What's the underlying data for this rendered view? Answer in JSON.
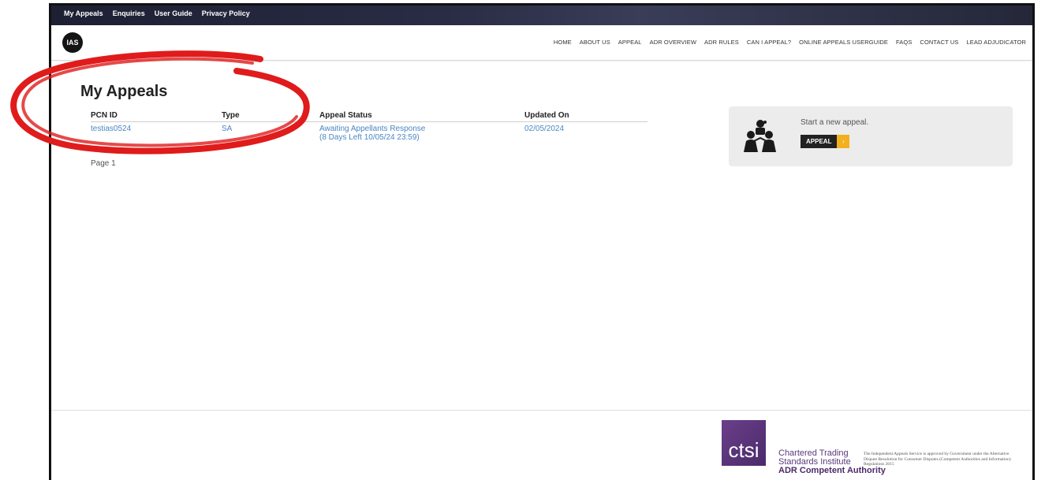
{
  "topbar": {
    "links": [
      "My Appeals",
      "Enquiries",
      "User Guide",
      "Privacy Policy"
    ]
  },
  "header": {
    "logo_text": "IAS",
    "nav": [
      "HOME",
      "ABOUT US",
      "APPEAL",
      "ADR OVERVIEW",
      "ADR RULES",
      "CAN I APPEAL?",
      "ONLINE APPEALS USERGUIDE",
      "FAQS",
      "CONTACT US",
      "LEAD ADJUDICATOR"
    ]
  },
  "main": {
    "title": "My Appeals",
    "table": {
      "headers": [
        "PCN ID",
        "Type",
        "Appeal Status",
        "Updated On"
      ],
      "rows": [
        {
          "pcn_id": "testias0524",
          "type": "SA",
          "status_line1": "Awaiting Appellants Response",
          "status_line2": "(8 Days Left 10/05/24 23:59)",
          "updated_on": "02/05/2024"
        }
      ]
    },
    "pagination": "Page 1"
  },
  "card": {
    "message": "Start a new appeal.",
    "button_label": "APPEAL",
    "arrow": "›",
    "icon": "people-group-icon"
  },
  "footer": {
    "ctsi_logo_text": "ctsi",
    "ctsi_name_line1": "Chartered Trading",
    "ctsi_name_line2": "Standards Institute",
    "ctsi_authority": "ADR Competent Authority",
    "fine_print": "The Independent Appeals Service is approved by Government under the Alternative Dispute Resolution for Consumer Disputes (Competent Authorities and Information) Regulations 2015"
  },
  "colors": {
    "link_blue": "#4a86c4",
    "annotation_red": "#e01b1b",
    "button_accent": "#f2b01e",
    "ctsi_purple": "#5a3a7c"
  }
}
